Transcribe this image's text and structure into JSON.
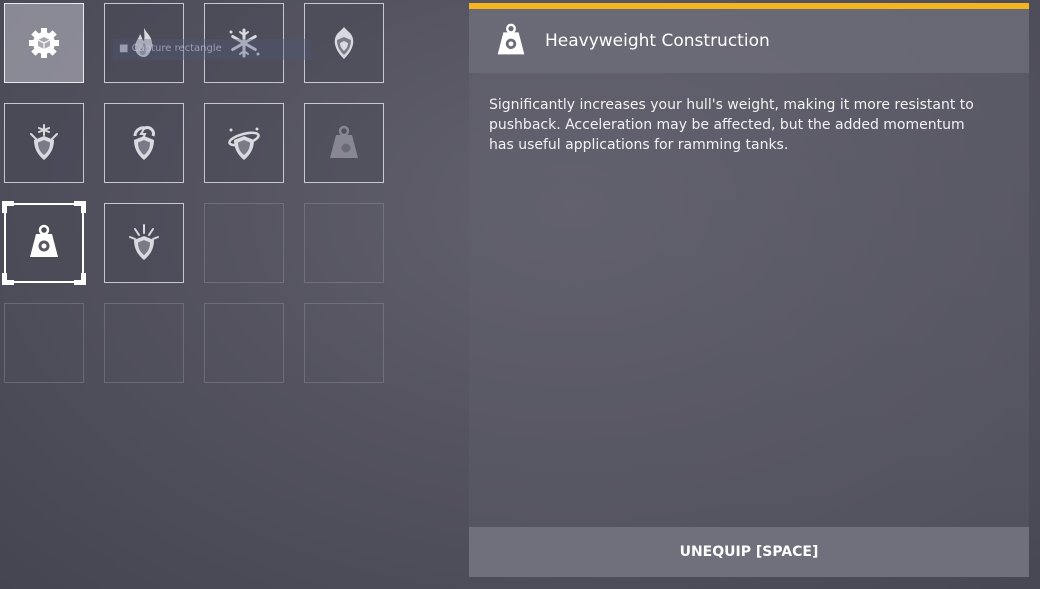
{
  "overlay": {
    "capture_label": "■ Capture rectangle"
  },
  "perks": [
    {
      "icon": "gear-box-icon",
      "state": "active"
    },
    {
      "icon": "flame-icon",
      "state": "normal"
    },
    {
      "icon": "snowflake-icon",
      "state": "normal"
    },
    {
      "icon": "fire-shield-icon",
      "state": "normal"
    },
    {
      "icon": "frost-shield-icon",
      "state": "normal"
    },
    {
      "icon": "shock-shield-icon",
      "state": "normal"
    },
    {
      "icon": "orbit-shield-icon",
      "state": "normal"
    },
    {
      "icon": "weight-icon",
      "state": "locked"
    },
    {
      "icon": "heavyweight-icon",
      "state": "selected"
    },
    {
      "icon": "spark-shield-icon",
      "state": "normal"
    },
    {
      "icon": "",
      "state": "empty"
    },
    {
      "icon": "",
      "state": "empty"
    },
    {
      "icon": "",
      "state": "empty"
    },
    {
      "icon": "",
      "state": "empty"
    },
    {
      "icon": "",
      "state": "empty"
    },
    {
      "icon": "",
      "state": "empty"
    }
  ],
  "details": {
    "icon": "heavyweight-icon",
    "title": "Heavyweight Construction",
    "description": "Significantly increases your hull's weight, making it more resistant to pushback. Acceleration may be affected, but the added momentum has useful applications for ramming tanks.",
    "accent_color": "#f4b51e"
  },
  "actions": {
    "unequip_label": "UNEQUIP [SPACE]"
  }
}
